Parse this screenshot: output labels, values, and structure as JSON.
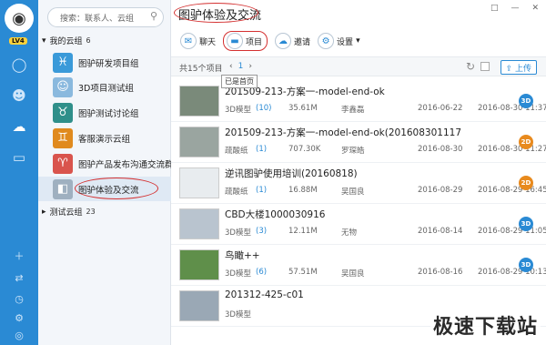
{
  "rail": {
    "level": "LV4",
    "active_index": 2
  },
  "sidebar": {
    "search_placeholder": "搜索：联系人、云组",
    "my_groups_label": "我的云组",
    "my_groups_count": "6",
    "groups": [
      {
        "name": "图驴研发项目组",
        "color": "#3a9ad9",
        "glyph": "♓",
        "icon": "pisces-icon"
      },
      {
        "name": "3D项目测试组",
        "color": "#8ab9de",
        "glyph": "☺",
        "icon": "avatar-icon"
      },
      {
        "name": "图驴测试讨论组",
        "color": "#2f8f8a",
        "glyph": "♉",
        "icon": "taurus-icon"
      },
      {
        "name": "客服演示云组",
        "color": "#e08a1e",
        "glyph": "♊",
        "icon": "gemini-icon"
      },
      {
        "name": "图驴产品发布沟通交流群",
        "color": "#d9544d",
        "glyph": "♈",
        "icon": "aries-icon"
      },
      {
        "name": "图驴体验及交流",
        "color": "#9fb0c0",
        "glyph": "◧",
        "icon": "group-icon"
      }
    ],
    "test_groups_label": "测试云组",
    "test_groups_count": "23"
  },
  "main": {
    "title": "图驴体验及交流",
    "window_buttons": [
      "□",
      "—",
      "✕"
    ],
    "toolbar": [
      {
        "label": "聊天",
        "icon": "chat-icon",
        "glyph": "✉"
      },
      {
        "label": "项目",
        "icon": "folder-icon",
        "glyph": "▬"
      },
      {
        "label": "邀请",
        "icon": "cloud-icon",
        "glyph": "☁"
      },
      {
        "label": "设置",
        "icon": "gear-icon",
        "glyph": "⚙"
      }
    ],
    "settings_caret": "▾",
    "total": "共15个项目",
    "page": "1",
    "prev": "‹",
    "next": "›",
    "tooltip": "已是首页",
    "upload": "上传",
    "files": [
      {
        "name": "201509-213-方案一-model-end-ok",
        "type": "3D模型",
        "ver": "(10)",
        "size": "35.61M",
        "user": "李鑫磊",
        "created": "2016-06-22",
        "updated": "2016-08-30 11:37",
        "badge": "3D",
        "badge_color": "#2a8ad4",
        "thumb": "#7a8a7a"
      },
      {
        "name": "201509-213-方案一-model-end-ok(201608301117",
        "type": "疏酸纸",
        "ver": "(1)",
        "size": "707.30K",
        "user": "罗琛皓",
        "created": "2016-08-30",
        "updated": "2016-08-30 11:27",
        "badge": "2D",
        "badge_color": "#e88a1e",
        "thumb": "#9aa5a0"
      },
      {
        "name": "逆讯图驴使用培训(20160818)",
        "type": "疏酸纸",
        "ver": "(1)",
        "size": "16.88M",
        "user": "吴国良",
        "created": "2016-08-29",
        "updated": "2016-08-29 16:45",
        "badge": "2D",
        "badge_color": "#e88a1e",
        "thumb": "#e8ecef"
      },
      {
        "name": "CBD大楼1000030916",
        "type": "3D模型",
        "ver": "(3)",
        "size": "12.11M",
        "user": "无物",
        "created": "2016-08-14",
        "updated": "2016-08-29 11:05",
        "badge": "3D",
        "badge_color": "#2a8ad4",
        "thumb": "#b9c4cf"
      },
      {
        "name": "鸟瞰++",
        "type": "3D模型",
        "ver": "(6)",
        "size": "57.51M",
        "user": "吴国良",
        "created": "2016-08-16",
        "updated": "2016-08-29 10:13",
        "badge": "3D",
        "badge_color": "#2a8ad4",
        "thumb": "#5f8f4a"
      },
      {
        "name": "201312-425-c01",
        "type": "3D模型",
        "ver": "",
        "size": "",
        "user": "",
        "created": "",
        "updated": "",
        "badge": "",
        "badge_color": "#2a8ad4",
        "thumb": "#9aa8b5"
      }
    ]
  },
  "watermark": "极速下载站"
}
